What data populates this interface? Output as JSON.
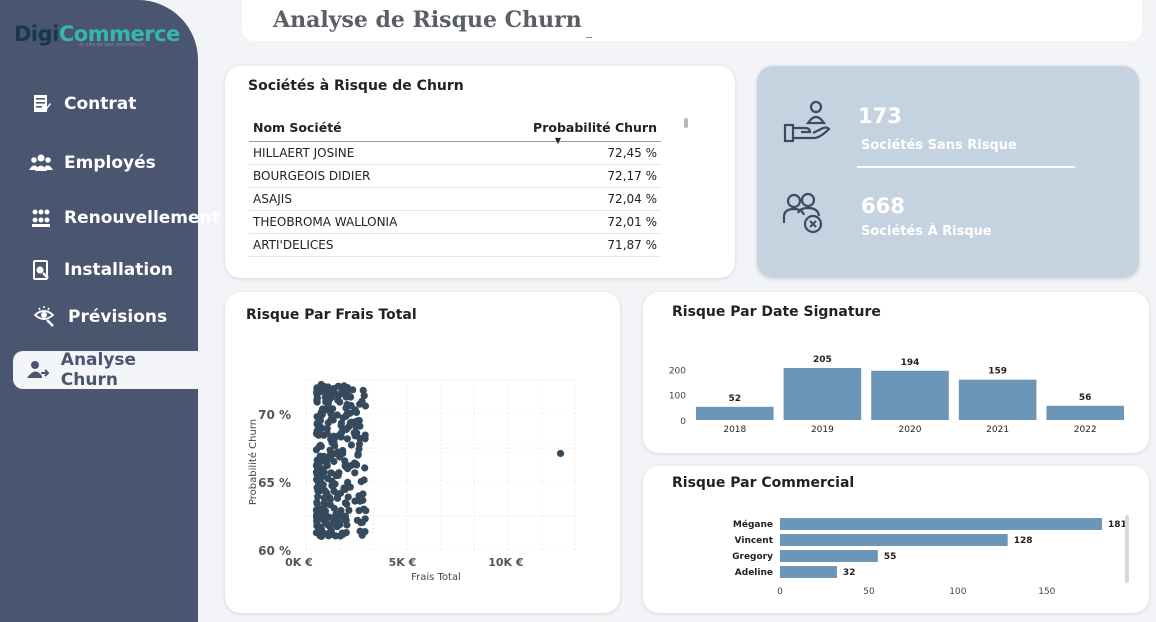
{
  "brand": {
    "name_part1": "Digi",
    "name_part2": "Commerce",
    "tagline": "un site de test commercial"
  },
  "page": {
    "title": "Analyse de Risque Churn"
  },
  "nav": [
    {
      "label": "Contrat",
      "icon": "contract-icon"
    },
    {
      "label": "Employés",
      "icon": "employees-icon"
    },
    {
      "label": "Renouvellement",
      "icon": "renewal-icon"
    },
    {
      "label": "Installation",
      "icon": "installation-icon"
    },
    {
      "label": "Prévisions",
      "icon": "forecast-icon"
    },
    {
      "label": "Analyse Churn",
      "icon": "churn-icon",
      "active": true
    }
  ],
  "table": {
    "title": "Sociétés à Risque de Churn",
    "columns": [
      "Nom Société",
      "Probabilité Churn"
    ],
    "rows": [
      [
        "HILLAERT JOSINE",
        "72,45 %"
      ],
      [
        "BOURGEOIS DIDIER",
        "72,17 %"
      ],
      [
        "ASAJIS",
        "72,04 %"
      ],
      [
        "THEOBROMA WALLONIA",
        "72,01 %"
      ],
      [
        "ARTI'DELICES",
        "71,87 %"
      ]
    ]
  },
  "kpis": [
    {
      "value": "173",
      "label": "Sociétés Sans Risque",
      "icon": "hand-person-icon"
    },
    {
      "value": "668",
      "label": "Sociétés À Risque",
      "icon": "group-remove-icon"
    }
  ],
  "colors": {
    "sidebar": "#4a5570",
    "bar": "#6b96b8",
    "scatter": "#354a5c",
    "kpi_bg": "#c4d3df"
  },
  "chart_data": [
    {
      "type": "scatter",
      "title": "Risque Par Frais Total",
      "xlabel": "Frais Total",
      "ylabel": "Probabilité Churn",
      "xticks": [
        "0K €",
        "5K €",
        "10K €"
      ],
      "yticks": [
        "60 %",
        "65 %",
        "70 %"
      ],
      "xlim": [
        0,
        13000
      ],
      "ylim": [
        60,
        72.5
      ],
      "outlier": {
        "x": 12300,
        "y": 67.1
      }
    },
    {
      "type": "bar",
      "title": "Risque Par Date Signature",
      "categories": [
        "2018",
        "2019",
        "2020",
        "2021",
        "2022"
      ],
      "values": [
        52,
        205,
        194,
        159,
        56
      ],
      "yticks": [
        0,
        100,
        200
      ],
      "ylim": [
        0,
        205
      ]
    },
    {
      "type": "bar",
      "orientation": "horizontal",
      "title": "Risque Par Commercial",
      "categories": [
        "Mégane",
        "Vincent",
        "Gregory",
        "Adeline"
      ],
      "values": [
        181,
        128,
        55,
        32
      ],
      "xticks": [
        0,
        50,
        100,
        150
      ],
      "xlim": [
        0,
        190
      ]
    }
  ]
}
